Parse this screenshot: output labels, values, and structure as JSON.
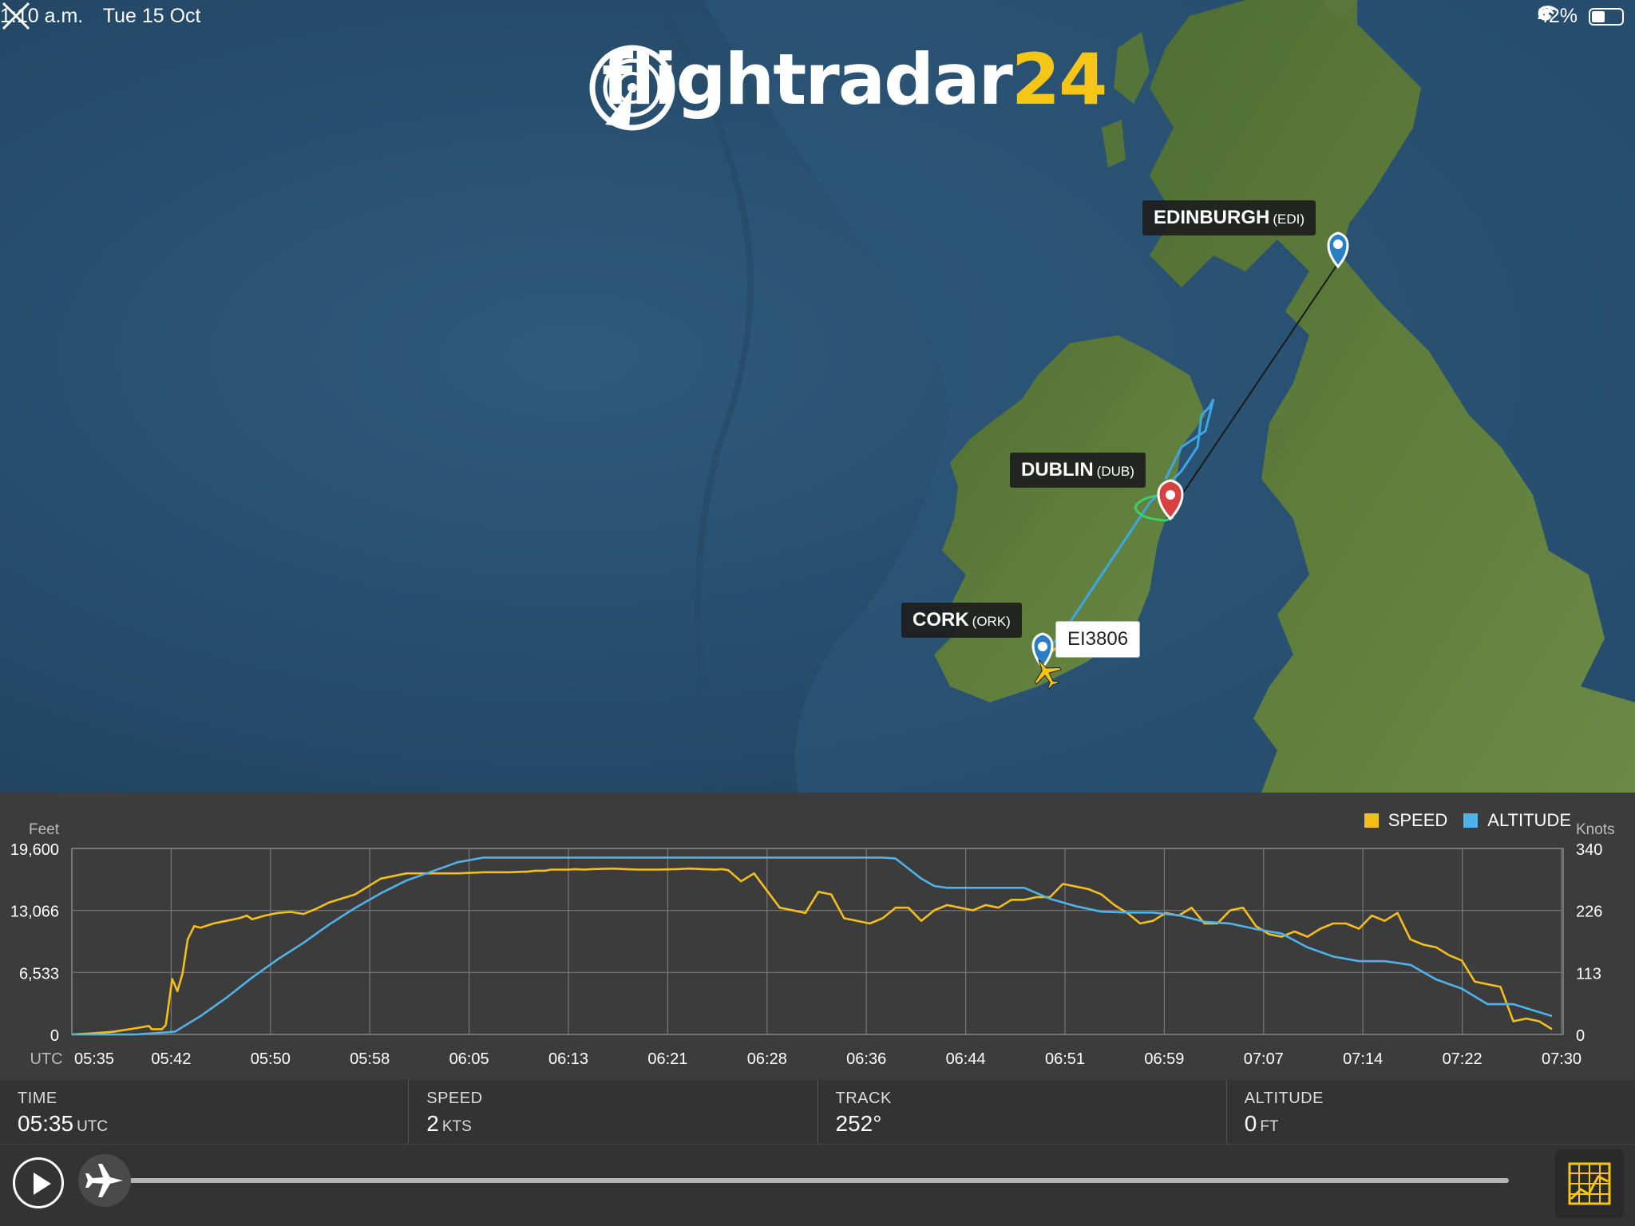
{
  "status_bar": {
    "time": "1:10 a.m.",
    "date": "Tue 15 Oct",
    "battery": "42%"
  },
  "logo": {
    "text": "flightradar",
    "number": "24",
    "accent_color": "#f5c518"
  },
  "map": {
    "airports": [
      {
        "name": "EDINBURGH",
        "code": "(EDI)",
        "pin_color": "#2a7fc4"
      },
      {
        "name": "DUBLIN",
        "code": "(DUB)",
        "pin_color": "#d8413f"
      },
      {
        "name": "CORK",
        "code": "(ORK)",
        "pin_color": "#2a7fc4"
      }
    ],
    "flight": "EI3806"
  },
  "legend": {
    "speed": "SPEED",
    "altitude": "ALTITUDE",
    "speed_color": "#f5bf1b",
    "altitude_color": "#4fb3ea"
  },
  "chart_data": {
    "type": "line",
    "left_axis_label": "Feet",
    "right_axis_label": "Knots",
    "left_ticks": [
      "19,600",
      "13,066",
      "6,533",
      "0"
    ],
    "right_ticks": [
      "340",
      "226",
      "113",
      "0"
    ],
    "x_prefix": "UTC",
    "x_ticks": [
      "05:35",
      "05:42",
      "05:50",
      "05:58",
      "06:05",
      "06:13",
      "06:21",
      "06:28",
      "06:36",
      "06:44",
      "06:51",
      "06:59",
      "07:07",
      "07:14",
      "07:22",
      "07:30"
    ],
    "ylim_feet": [
      0,
      19600
    ],
    "ylim_knots": [
      0,
      340
    ],
    "grid": true,
    "series": [
      {
        "name": "SPEED",
        "unit": "kts",
        "x": [
          0,
          1.5,
          3.2,
          5.0,
          6.0,
          6.2,
          7.0,
          7.3,
          7.8,
          8.2,
          8.6,
          9.0,
          9.5,
          10.0,
          11.0,
          12.0,
          13.0,
          13.6,
          14.0,
          15.0,
          16.0,
          17.0,
          18.0,
          19.0,
          20.0,
          22.0,
          24.0,
          26.0,
          28.0,
          30.0,
          32.0,
          34.0,
          35.0,
          35.3,
          36.0,
          36.8,
          37.2,
          37.8,
          38.6,
          39.1,
          39.8,
          40.4,
          42.0,
          43.0,
          44.0,
          45.5,
          47.0,
          48.0,
          49.0,
          50.0,
          50.5,
          51.0,
          52.0,
          53.0,
          55.0,
          57.0,
          58.0,
          59.0,
          60.0,
          62.0,
          63.0,
          64.0,
          65.0,
          66.0,
          67.0,
          68.0,
          69.0,
          70.0,
          71.0,
          72.0,
          73.0,
          74.0,
          75.0,
          76.0,
          77.0,
          78.0,
          79.0,
          80.0,
          81.0,
          82.0,
          83.0,
          84.0,
          85.0,
          86.0,
          87.0,
          88.0,
          89.0,
          90.0,
          91.0,
          92.0,
          93.0,
          94.0,
          95.0,
          96.0,
          97.0,
          98.0,
          99.0,
          100.0,
          101.0,
          102.0,
          103.0,
          104.0,
          105.0,
          106.0,
          107.0,
          108.0,
          109.0,
          110.0,
          111.0,
          112.0,
          113.0,
          114.0,
          115.0
        ],
        "values": [
          0,
          2,
          5,
          12,
          16,
          10,
          10,
          18,
          105,
          82,
          115,
          180,
          205,
          202,
          210,
          215,
          220,
          225,
          218,
          225,
          230,
          232,
          228,
          238,
          250,
          265,
          295,
          305,
          305,
          305,
          307,
          307,
          308,
          308,
          310,
          310,
          312,
          312,
          312,
          313,
          312,
          313,
          314,
          313,
          312,
          312,
          313,
          314,
          313,
          312,
          313,
          311,
          290,
          305,
          240,
          230,
          270,
          265,
          220,
          210,
          220,
          240,
          240,
          215,
          235,
          245,
          240,
          235,
          245,
          240,
          255,
          255,
          260,
          260,
          285,
          280,
          275,
          265,
          245,
          230,
          210,
          215,
          230,
          225,
          240,
          210,
          210,
          235,
          240,
          205,
          190,
          185,
          195,
          185,
          200,
          210,
          210,
          200,
          225,
          215,
          230,
          180,
          170,
          165,
          150,
          140,
          100,
          95,
          90,
          25,
          30,
          25,
          10
        ]
      },
      {
        "name": "ALTITUDE",
        "unit": "ft",
        "x": [
          0,
          5,
          8,
          10,
          12,
          14,
          16,
          18,
          20,
          22,
          24,
          26,
          28,
          30,
          32,
          34,
          36,
          40,
          45,
          50,
          55,
          60,
          63,
          64,
          66,
          67,
          68,
          70,
          72,
          74,
          76,
          78,
          80,
          82,
          84,
          86,
          88,
          90,
          92,
          94,
          96,
          98,
          100,
          102,
          104,
          106,
          108,
          110,
          112,
          115
        ],
        "values": [
          0,
          0,
          300,
          2000,
          4000,
          6200,
          8200,
          10000,
          12000,
          13800,
          15400,
          16800,
          17800,
          18800,
          19300,
          19300,
          19300,
          19300,
          19300,
          19300,
          19300,
          19300,
          19300,
          19200,
          17000,
          16200,
          16000,
          16000,
          16000,
          16000,
          14800,
          14000,
          13400,
          13300,
          13300,
          13000,
          12300,
          12100,
          11500,
          11000,
          9500,
          8500,
          8000,
          8000,
          7600,
          6000,
          5000,
          3300,
          3300,
          2000
        ]
      }
    ]
  },
  "info": {
    "time_label": "TIME",
    "time_value": "05:35",
    "time_unit": "UTC",
    "speed_label": "SPEED",
    "speed_value": "2",
    "speed_unit": "KTS",
    "track_label": "TRACK",
    "track_value": "252°",
    "altitude_label": "ALTITUDE",
    "altitude_value": "0",
    "altitude_unit": "FT"
  },
  "playback": {
    "progress": 0
  }
}
